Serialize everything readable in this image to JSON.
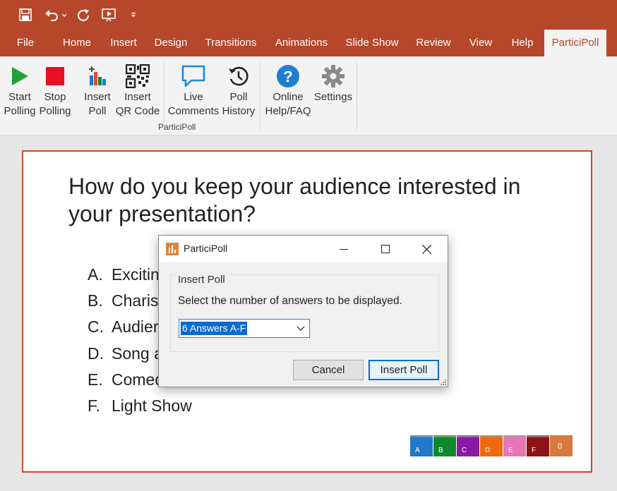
{
  "quick_access": {
    "save_icon": "save-icon",
    "undo_icon": "undo-icon",
    "redo_icon": "redo-icon",
    "present_icon": "start-from-beginning-icon",
    "customize_icon": "customize-qat-icon"
  },
  "tabs": [
    {
      "label": "File"
    },
    {
      "label": "Home"
    },
    {
      "label": "Insert"
    },
    {
      "label": "Design"
    },
    {
      "label": "Transitions"
    },
    {
      "label": "Animations"
    },
    {
      "label": "Slide Show"
    },
    {
      "label": "Review"
    },
    {
      "label": "View"
    },
    {
      "label": "Help"
    },
    {
      "label": "ParticiPoll",
      "active": true
    }
  ],
  "ribbon": {
    "buttons": [
      {
        "line1": "Start",
        "line2": "Polling",
        "icon": "play-icon"
      },
      {
        "line1": "Stop",
        "line2": "Polling",
        "icon": "stop-icon"
      },
      {
        "line1": "Insert",
        "line2": "Poll",
        "icon": "insert-poll-icon"
      },
      {
        "line1": "Insert",
        "line2": "QR Code",
        "icon": "qr-code-icon"
      },
      {
        "line1": "Live",
        "line2": "Comments",
        "icon": "comment-icon"
      },
      {
        "line1": "Poll",
        "line2": "History",
        "icon": "history-icon"
      },
      {
        "line1": "Online",
        "line2": "Help/FAQ",
        "icon": "help-icon"
      },
      {
        "line1": "Settings",
        "line2": "",
        "icon": "gear-icon"
      }
    ],
    "group_label": "ParticiPoll",
    "colors": {
      "play": "#22a33a",
      "stop": "#e81123",
      "accent_blue": "#1e88d8"
    }
  },
  "slide": {
    "question": "How do you keep your audience interested in your presentation?",
    "answers": [
      {
        "letter": "A.",
        "text": "Excitin"
      },
      {
        "letter": "B.",
        "text": "Charis"
      },
      {
        "letter": "C.",
        "text": "Audier"
      },
      {
        "letter": "D.",
        "text": "Song a"
      },
      {
        "letter": "E.",
        "text": "Comed"
      },
      {
        "letter": "F.",
        "text": "Light Show"
      }
    ],
    "result_bars": [
      {
        "label": "A",
        "color": "#1f78c8"
      },
      {
        "label": "B",
        "color": "#0f8a2a"
      },
      {
        "label": "C",
        "color": "#8b1aa3"
      },
      {
        "label": "D",
        "color": "#f06a0d"
      },
      {
        "label": "E",
        "color": "#e877b8"
      },
      {
        "label": "F",
        "color": "#8b1414"
      }
    ],
    "response_count": "0"
  },
  "dialog": {
    "title": "ParticiPoll",
    "group_title": "Insert Poll",
    "prompt": "Select the number of answers to be displayed.",
    "selected_option": "6 Answers A-F",
    "cancel_label": "Cancel",
    "insert_label": "Insert Poll"
  }
}
